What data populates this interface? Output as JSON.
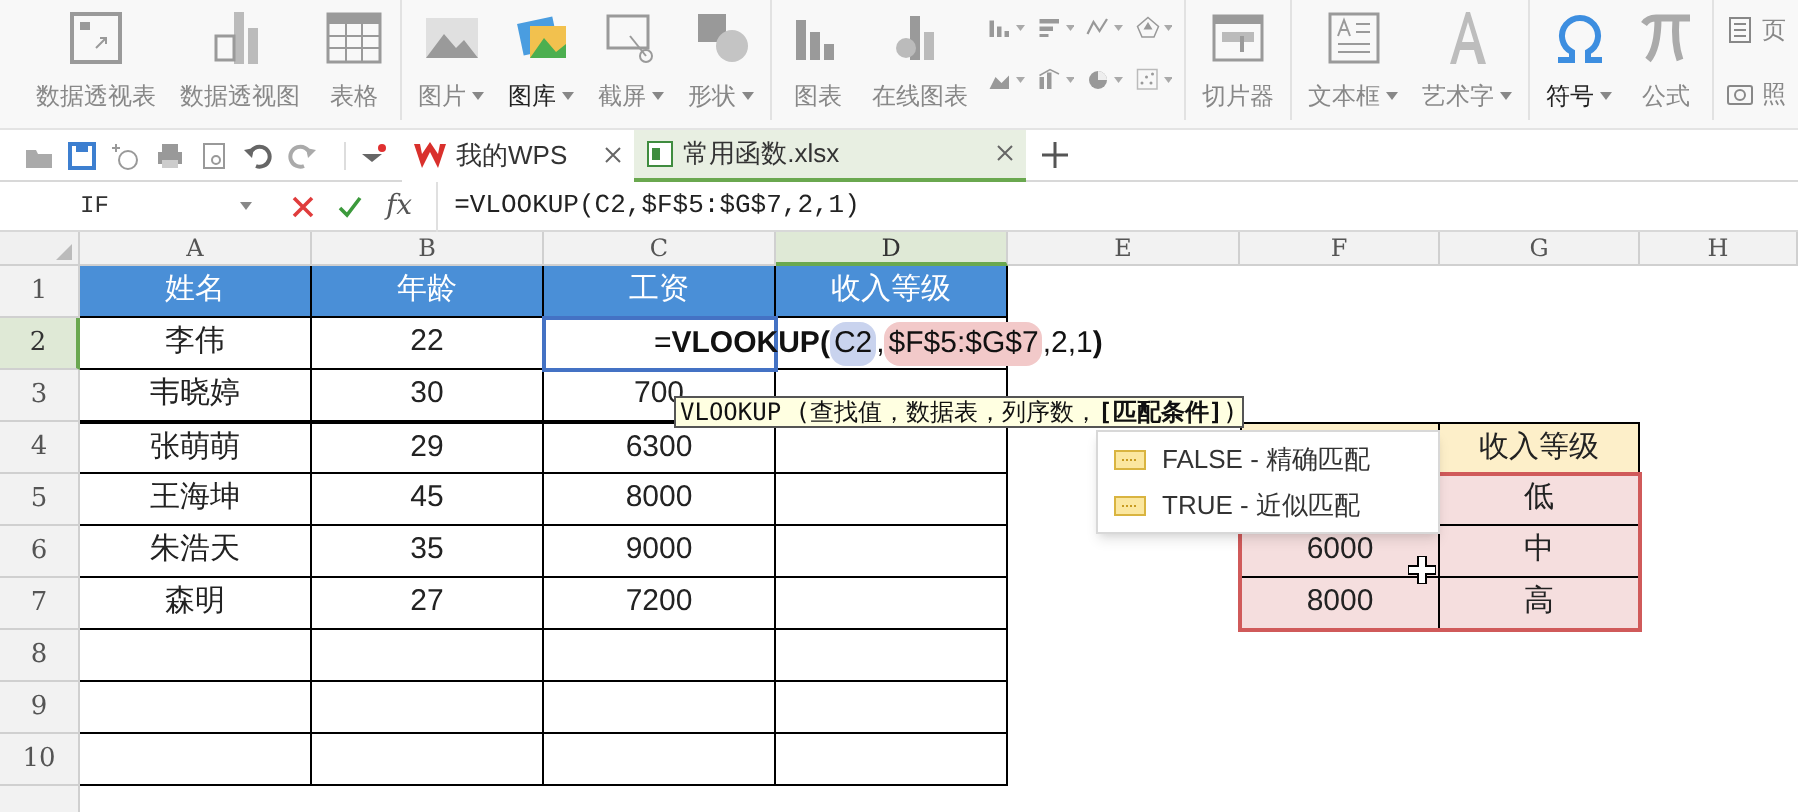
{
  "ribbon": {
    "groups": [
      {
        "kind": "buttons",
        "items": [
          {
            "label": "数据透视表",
            "dropdown": false,
            "emphasized": false
          },
          {
            "label": "数据透视图",
            "dropdown": false,
            "emphasized": false
          },
          {
            "label": "表格",
            "dropdown": false,
            "emphasized": false
          }
        ]
      },
      {
        "kind": "buttons",
        "items": [
          {
            "label": "图片",
            "dropdown": true,
            "emphasized": false
          },
          {
            "label": "图库",
            "dropdown": true,
            "emphasized": true
          },
          {
            "label": "截屏",
            "dropdown": true,
            "emphasized": false
          },
          {
            "label": "形状",
            "dropdown": true,
            "emphasized": false
          }
        ]
      },
      {
        "kind": "chart_gallery",
        "items": [
          {
            "label": "图表",
            "dropdown": false,
            "emphasized": false
          },
          {
            "label": "在线图表",
            "dropdown": false,
            "emphasized": false
          }
        ]
      },
      {
        "kind": "buttons",
        "items": [
          {
            "label": "切片器",
            "dropdown": false,
            "emphasized": false
          }
        ]
      },
      {
        "kind": "buttons",
        "items": [
          {
            "label": "文本框",
            "dropdown": true,
            "emphasized": false
          },
          {
            "label": "艺术字",
            "dropdown": true,
            "emphasized": false
          }
        ]
      },
      {
        "kind": "buttons",
        "items": [
          {
            "label": "符号",
            "dropdown": true,
            "emphasized": true
          },
          {
            "label": "公式",
            "dropdown": false,
            "emphasized": false
          }
        ]
      },
      {
        "kind": "side",
        "items": [
          {
            "label": "页",
            "emphasized": false
          },
          {
            "label": "照",
            "emphasized": false
          }
        ]
      }
    ]
  },
  "file_tabs": [
    {
      "label": "我的WPS",
      "selected": false,
      "closable": true
    },
    {
      "label": "常用函数.xlsx",
      "selected": true,
      "closable": true
    }
  ],
  "formula_bar": {
    "name_box": "IF",
    "function_label": "fx",
    "formula": "=VLOOKUP(C2,$F$5:$G$7,2,1)"
  },
  "sheet": {
    "columns": [
      {
        "label": "A",
        "selected": false
      },
      {
        "label": "B",
        "selected": false
      },
      {
        "label": "C",
        "selected": false
      },
      {
        "label": "D",
        "selected": true
      },
      {
        "label": "E",
        "selected": false
      },
      {
        "label": "F",
        "selected": false
      },
      {
        "label": "G",
        "selected": false
      },
      {
        "label": "H",
        "selected": false
      }
    ],
    "rows": [
      {
        "number": "1",
        "selected": false,
        "cells": {
          "A": "姓名",
          "B": "年龄",
          "C": "工资",
          "D": "收入等级"
        }
      },
      {
        "number": "2",
        "selected": true,
        "cells": {
          "A": "李伟",
          "B": "22"
        }
      },
      {
        "number": "3",
        "selected": false,
        "cells": {
          "A": "韦晓婷",
          "B": "30",
          "C": "700"
        }
      },
      {
        "number": "4",
        "selected": false,
        "cells": {
          "A": "张萌萌",
          "B": "29",
          "C": "6300",
          "G": "收入等级"
        }
      },
      {
        "number": "5",
        "selected": false,
        "cells": {
          "A": "王海坤",
          "B": "45",
          "C": "8000",
          "G": "低"
        }
      },
      {
        "number": "6",
        "selected": false,
        "cells": {
          "A": "朱浩天",
          "B": "35",
          "C": "9000",
          "F": "6000",
          "G": "中"
        }
      },
      {
        "number": "7",
        "selected": false,
        "cells": {
          "A": "森明",
          "B": "27",
          "C": "7200",
          "F": "8000",
          "G": "高"
        }
      },
      {
        "number": "8",
        "selected": false,
        "cells": {}
      },
      {
        "number": "9",
        "selected": false,
        "cells": {}
      },
      {
        "number": "10",
        "selected": false,
        "cells": {}
      }
    ],
    "in_cell_editor": {
      "parts": [
        {
          "text": "=",
          "kind": "plain"
        },
        {
          "text": "VLOOKUP(",
          "kind": "function"
        },
        {
          "text": "C2",
          "kind": "ref",
          "color": "#c9d3ee"
        },
        {
          "text": ",",
          "kind": "plain"
        },
        {
          "text": "$F$5:$G$7",
          "kind": "ref",
          "color": "#f2c9c9"
        },
        {
          "text": ",2,1",
          "kind": "plain"
        },
        {
          "text": ")",
          "kind": "function"
        }
      ]
    },
    "tooltip": "VLOOKUP (查找值，数据表，列序数，**[匹配条件]**)",
    "autocomplete": [
      {
        "label": "FALSE - 精确匹配"
      },
      {
        "label": "TRUE - 近似匹配"
      }
    ]
  }
}
